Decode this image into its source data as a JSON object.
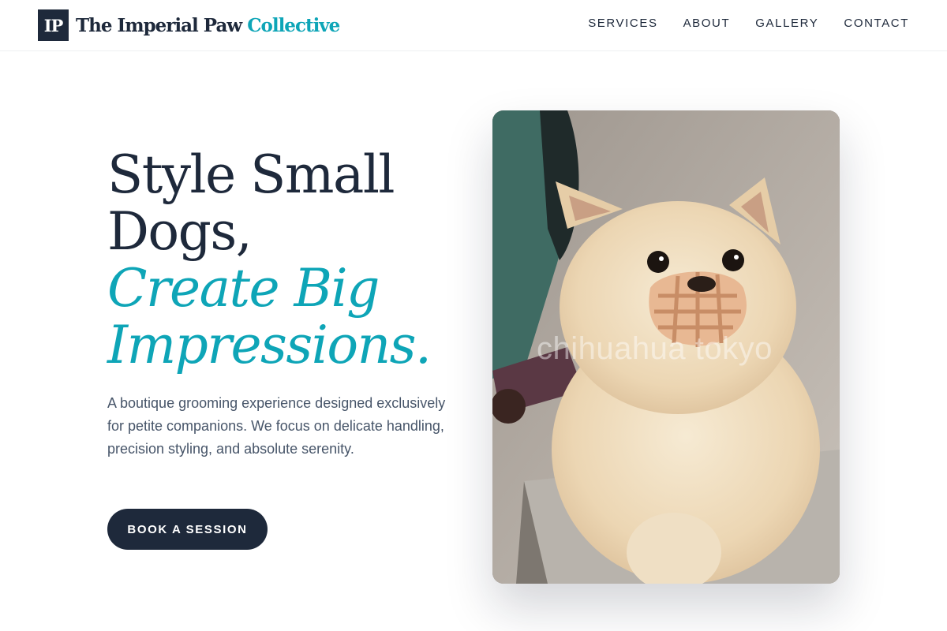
{
  "brand": {
    "monogram": "IP",
    "name_main": "The Imperial Paw",
    "name_accent": "Collective",
    "accent_color": "#0ea5b7",
    "dark_color": "#1e293b"
  },
  "nav": {
    "items": [
      {
        "label": "SERVICES"
      },
      {
        "label": "ABOUT"
      },
      {
        "label": "GALLERY"
      },
      {
        "label": "CONTACT"
      }
    ]
  },
  "hero": {
    "title_line1": "Style Small",
    "title_line2": "Dogs,",
    "title_accent_line1": "Create Big",
    "title_accent_line2": "Impressions.",
    "description": "A boutique grooming experience designed exclusively for petite companions. We focus on delicate handling, precision styling, and absolute serenity.",
    "cta_label": "BOOK A SESSION"
  },
  "photo": {
    "watermark": "chihuahua tokyo"
  }
}
